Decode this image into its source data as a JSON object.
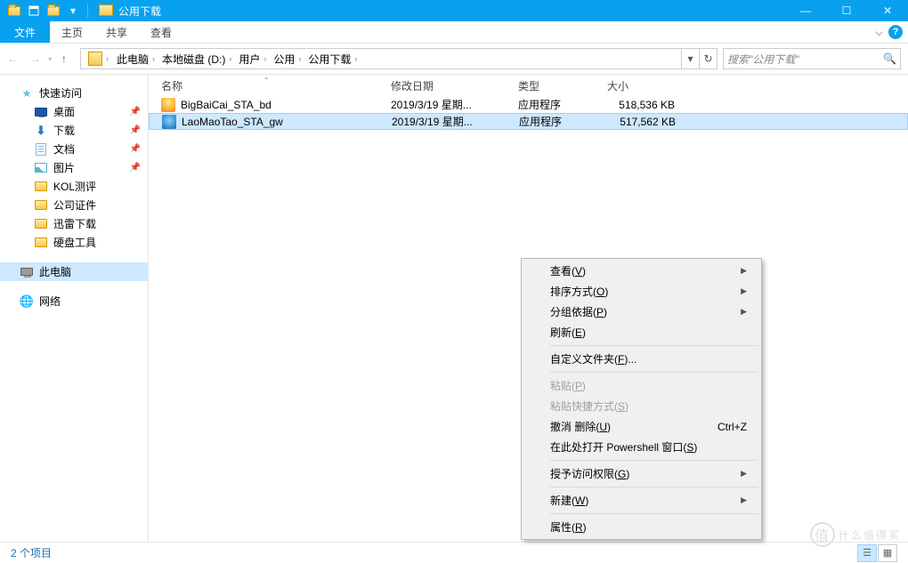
{
  "window": {
    "title": "公用下载",
    "ribbon_tabs": {
      "file": "文件",
      "home": "主页",
      "share": "共享",
      "view": "查看"
    },
    "win_icons": {
      "minimize": "—",
      "maximize": "☐",
      "close": "✕"
    }
  },
  "navbar": {
    "back_icon": "←",
    "fwd_icon": "→",
    "up_icon": "↑",
    "crumbs": [
      "此电脑",
      "本地磁盘 (D:)",
      "用户",
      "公用",
      "公用下载"
    ],
    "search_placeholder": "搜索\"公用下载\"",
    "search_icon": "🔍",
    "dropdown_icon": "▾",
    "refresh_icon": "↻"
  },
  "sidebar": {
    "quick_access": "快速访问",
    "quick_items": [
      {
        "label": "桌面",
        "icon": "desktop",
        "pinned": true
      },
      {
        "label": "下载",
        "icon": "dl",
        "pinned": true
      },
      {
        "label": "文档",
        "icon": "doc",
        "pinned": true
      },
      {
        "label": "图片",
        "icon": "pic",
        "pinned": true
      },
      {
        "label": "KOL测评",
        "icon": "folder",
        "pinned": false
      },
      {
        "label": "公司证件",
        "icon": "folder",
        "pinned": false
      },
      {
        "label": "迅雷下载",
        "icon": "folder",
        "pinned": false
      },
      {
        "label": "硬盘工具",
        "icon": "folder",
        "pinned": false
      }
    ],
    "this_pc": "此电脑",
    "network": "网络"
  },
  "columns": {
    "name": "名称",
    "date": "修改日期",
    "type": "类型",
    "size": "大小",
    "sort_caret": "⌃"
  },
  "files": [
    {
      "name": "BigBaiCai_STA_bd",
      "date": "2019/3/19 星期...",
      "type": "应用程序",
      "size": "518,536 KB",
      "selected": false
    },
    {
      "name": "LaoMaoTao_STA_gw",
      "date": "2019/3/19 星期...",
      "type": "应用程序",
      "size": "517,562 KB",
      "selected": true
    }
  ],
  "context_menu": [
    {
      "label_pre": "查看(",
      "key": "V",
      "label_post": ")",
      "submenu": true
    },
    {
      "label_pre": "排序方式(",
      "key": "O",
      "label_post": ")",
      "submenu": true
    },
    {
      "label_pre": "分组依据(",
      "key": "P",
      "label_post": ")",
      "submenu": true
    },
    {
      "label_pre": "刷新(",
      "key": "E",
      "label_post": ")"
    },
    {
      "sep": true
    },
    {
      "label_pre": "自定义文件夹(",
      "key": "F",
      "label_post": ")..."
    },
    {
      "sep": true
    },
    {
      "label_pre": "粘贴(",
      "key": "P",
      "label_post": ")",
      "disabled": true
    },
    {
      "label_pre": "粘贴快捷方式(",
      "key": "S",
      "label_post": ")",
      "disabled": true
    },
    {
      "label_pre": "撤消 删除(",
      "key": "U",
      "label_post": ")",
      "shortcut": "Ctrl+Z"
    },
    {
      "label_pre": "在此处打开 Powershell 窗口(",
      "key": "S",
      "label_post": ")"
    },
    {
      "sep": true
    },
    {
      "label_pre": "授予访问权限(",
      "key": "G",
      "label_post": ")",
      "submenu": true
    },
    {
      "sep": true
    },
    {
      "label_pre": "新建(",
      "key": "W",
      "label_post": ")",
      "submenu": true
    },
    {
      "sep": true
    },
    {
      "label_pre": "属性(",
      "key": "R",
      "label_post": ")"
    }
  ],
  "statusbar": {
    "text": "2 个项目",
    "view_details": "☰",
    "view_icons": "▦"
  },
  "watermark": {
    "text": "什么值得买",
    "icon": "值"
  }
}
